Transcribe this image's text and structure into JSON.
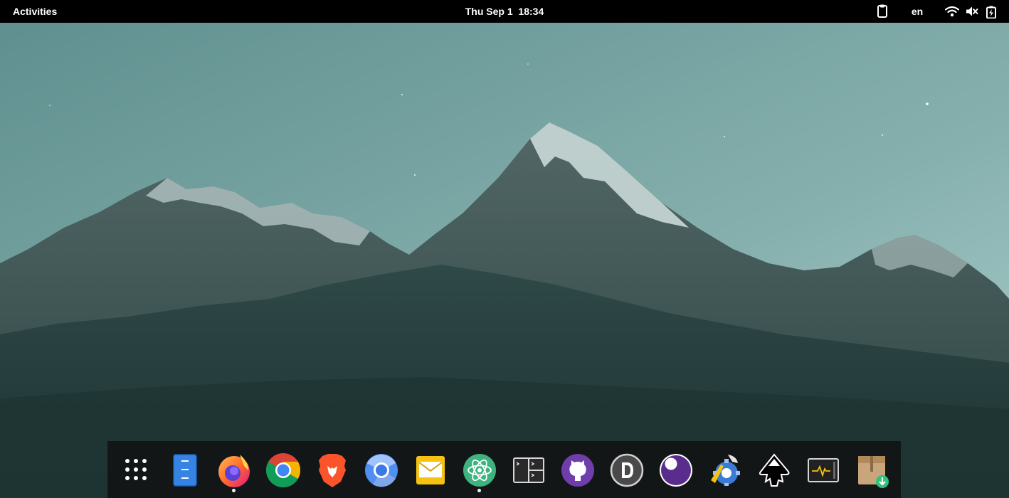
{
  "topbar": {
    "activities_label": "Activities",
    "clock_label": "Thu Sep 1  18:34",
    "language_label": "en",
    "indicators": [
      "clipboard-icon",
      "wifi-icon",
      "volume-muted-icon",
      "battery-charging-icon"
    ]
  },
  "wallpaper": {
    "subject": "snow-capped-mountains",
    "sky_color": "#8ab3b1",
    "mountain_color": "#2f4a49"
  },
  "dock": {
    "background": "#121416",
    "items": [
      {
        "name": "show-applications-icon",
        "running": false
      },
      {
        "name": "files-icon",
        "running": false
      },
      {
        "name": "firefox-icon",
        "running": true
      },
      {
        "name": "chrome-icon",
        "running": false
      },
      {
        "name": "brave-icon",
        "running": false
      },
      {
        "name": "chromium-icon",
        "running": false
      },
      {
        "name": "mail-icon",
        "running": false
      },
      {
        "name": "atom-icon",
        "running": true
      },
      {
        "name": "terminal-icon",
        "running": false
      },
      {
        "name": "github-desktop-icon",
        "running": false
      },
      {
        "name": "d-app-icon",
        "running": false
      },
      {
        "name": "eclipse-moon-icon",
        "running": false
      },
      {
        "name": "settings-tweaks-icon",
        "running": false
      },
      {
        "name": "inkscape-icon",
        "running": false
      },
      {
        "name": "system-monitor-icon",
        "running": false
      },
      {
        "name": "archive-manager-icon",
        "running": false
      }
    ]
  }
}
